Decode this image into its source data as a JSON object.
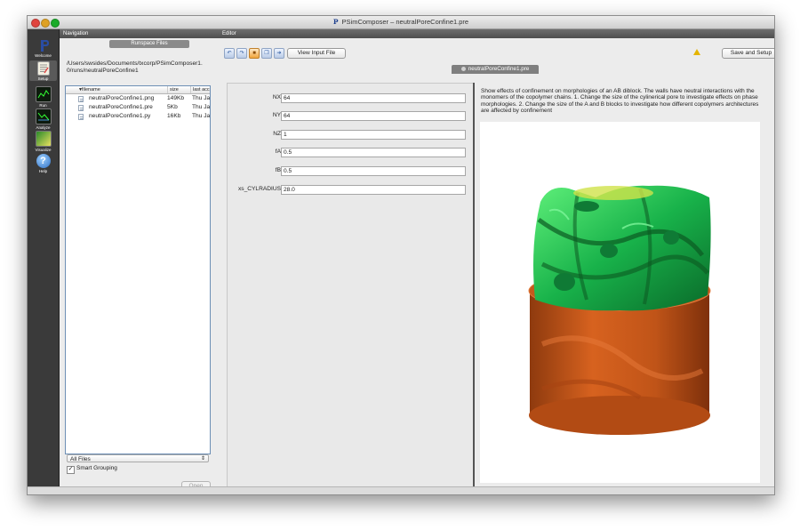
{
  "window": {
    "title": "PSimComposer – neutralPoreConfine1.pre"
  },
  "toolbar": {
    "items": [
      {
        "label": "Welcome",
        "icon": "p-logo-icon"
      },
      {
        "label": "Setup",
        "icon": "setup-document-icon"
      },
      {
        "label": "Run",
        "icon": "run-monitor-icon"
      },
      {
        "label": "Analyze",
        "icon": "analyze-monitor-icon"
      },
      {
        "label": "Visualize",
        "icon": "visualize-icon"
      },
      {
        "label": "Help",
        "icon": "help-icon"
      }
    ]
  },
  "navigation": {
    "header": "Navigation",
    "tab": "Runspace Files",
    "path": "/Users/swsides/Documents/txcorp/PSimComposer1.0/runs/neutralPoreConfine1",
    "columns": [
      "filename",
      "size",
      "last acc"
    ],
    "files": [
      {
        "name": "neutralPoreConfine1.png",
        "size": "149Kb",
        "date": "Thu Jan"
      },
      {
        "name": "neutralPoreConfine1.pre",
        "size": "5Kb",
        "date": "Thu Jan"
      },
      {
        "name": "neutralPoreConfine1.py",
        "size": "16Kb",
        "date": "Thu Jan"
      }
    ],
    "filter": "All Files",
    "smart_grouping": "Smart Grouping",
    "open": "Open"
  },
  "editor": {
    "header": "Editor",
    "view_input": "View Input File",
    "save_setup": "Save and Setup",
    "file_tab": "neutralPoreConfine1.pre",
    "params": [
      {
        "label": "NX",
        "value": "64"
      },
      {
        "label": "NY",
        "value": "64"
      },
      {
        "label": "NZ",
        "value": "1"
      },
      {
        "label": "fA",
        "value": "0.5"
      },
      {
        "label": "fB",
        "value": "0.5"
      },
      {
        "label": "xs_CYLRADIUS",
        "value": "28.0"
      }
    ],
    "description": "Show effects of confinement on morphologies of an AB diblock. The walls have neutral interactions with the monomers of the copolymer chains. 1. Change the size of the cylinerical pore to investigate effects on phase morphologies. 2. Change the size of the A and B blocks to investigate how different copolymers architectures are affected by confinement"
  },
  "colors": {
    "toolbar_bg": "#3a3a3a",
    "green_phase": "#1fc05a",
    "orange_phase": "#c2541a"
  }
}
